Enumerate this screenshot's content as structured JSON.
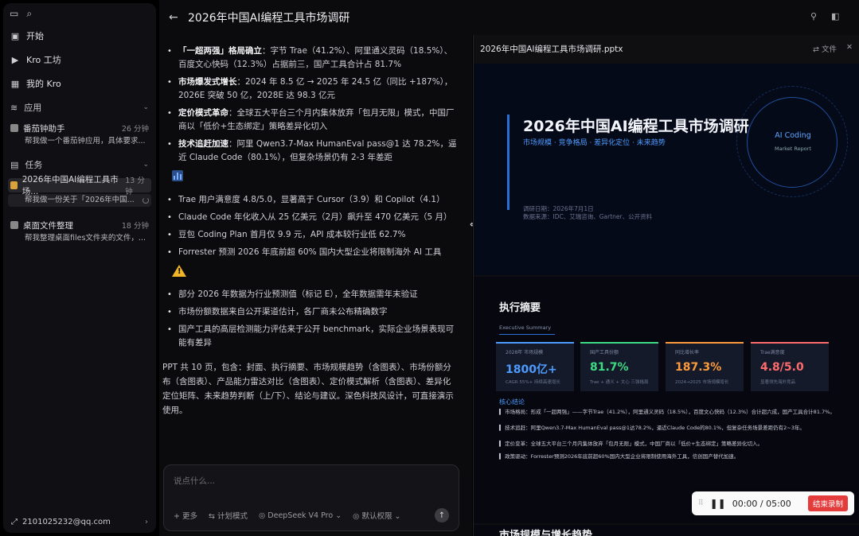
{
  "sidebar": {
    "nav": [
      {
        "icon": "chat-icon",
        "label": "开始"
      },
      {
        "icon": "play-icon",
        "label": "Kro 工坊"
      },
      {
        "icon": "grid-icon",
        "label": "我的 Kro"
      }
    ],
    "apps_label": "应用",
    "app_items": [
      {
        "title": "番茄钟助手",
        "time": "26 分钟",
        "sub": "帮我做一个番茄钟应用，具体要求..."
      }
    ],
    "tasks_label": "任务",
    "task_items": [
      {
        "title": "2026年中国AI编程工具市场...",
        "time": "13 分钟",
        "sub": "帮我做一份关于「2026年中国..."
      },
      {
        "title": "桌面文件整理",
        "time": "18 分钟",
        "sub": "帮我整理桌面files文件夹的文件，..."
      }
    ],
    "user_email": "2101025232@qq.com"
  },
  "topbar": {
    "title": "2026年中国AI编程工具市场调研"
  },
  "chat": {
    "bullets_a": [
      {
        "bold": "「一超两强」格局确立",
        "text": "：字节 Trae（41.2%）、阿里通义灵码（18.5%）、百度文心快码（12.3%）占据前三，国产工具合计占 81.7%"
      },
      {
        "bold": "市场爆发式增长",
        "text": "：2024 年 8.5 亿 → 2025 年 24.5 亿（同比 +187%），2026E 突破 50 亿，2028E 达 98.3 亿元"
      },
      {
        "bold": "定价模式革命",
        "text": "：全球五大平台三个月内集体放弃「包月无限」模式，中国厂商以「低价+生态绑定」策略差异化切入"
      },
      {
        "bold": "技术追赶加速",
        "text": "：阿里 Qwen3.7-Max HumanEval pass@1 达 78.2%，逼近 Claude Code（80.1%），但复杂场景仍有 2-3 年差距"
      }
    ],
    "bullets_b": [
      "Trae 用户满意度 4.8/5.0，显著高于 Cursor（3.9）和 Copilot（4.1）",
      "Claude Code 年化收入从 25 亿美元（2月）飙升至 470 亿美元（5 月）",
      "豆包 Coding Plan 首月仅 9.9 元，API 成本较行业低 62.7%",
      "Forrester 预测 2026 年底前超 60% 国内大型企业将限制海外 AI 工具"
    ],
    "bullets_c": [
      "部分 2026 年数据为行业预测值（标记 E），全年数据需年末验证",
      "市场份额数据来自公开渠道估计，各厂商未公布精确数字",
      "国产工具的高层检测能力评估来于公开 benchmark，实际企业场景表现可能有差异"
    ],
    "summary": "PPT 共 10 页，包含：封面、执行摘要、市场规模趋势（含图表）、市场份额分布（含图表）、产品能力雷达对比（含图表）、定价模式解析（含图表）、差异化定位矩阵、未来趋势判断（上/下）、结论与建议。深色科技风设计，可直接演示使用。",
    "input": {
      "placeholder": "说点什么...",
      "more": "+ 更多",
      "plan": "⇆ 计划模式",
      "model": "◎ DeepSeek V4 Pro ⌄",
      "default": "◎ 默认权限 ⌄"
    }
  },
  "preview": {
    "filename": "2026年中国AI编程工具市场调研.pptx",
    "file_btn": "⇄ 文件",
    "slide1": {
      "title": "2026年中国AI编程工具市场调研",
      "subtitle": "市场规模 · 竞争格局 · 差异化定位 · 未来趋势",
      "meta": "调研日期：2026年7月1日",
      "meta2": "数据来源：IDC、艾瑞咨询、Gartner、公开资料",
      "circle_title": "AI Coding",
      "circle_sub": "Market Report"
    },
    "slide2": {
      "title": "执行摘要",
      "subtitle": "Executive Summary",
      "cards": [
        {
          "label": "2028年 市场规模",
          "value": "1800亿+",
          "note": "CAGR 55%+ 持续高速增长",
          "color": "#4e9bff"
        },
        {
          "label": "国产工具份额",
          "value": "81.7%",
          "note": "Trae + 通义 + 文心 三强格局",
          "color": "#3ddc84"
        },
        {
          "label": "同比增长率",
          "value": "187.3%",
          "note": "2024→2025 市场规模增长",
          "color": "#ff9a3c"
        },
        {
          "label": "Trae满意度",
          "value": "4.8/5.0",
          "note": "显著领先海外竞品",
          "color": "#ff6b6b"
        }
      ],
      "key_title": "核心结论",
      "points": [
        "▍ 市场格局：形成「一超两强」——字节Trae（41.2%），阿里通义灵码（18.5%），百度文心快码（12.3%）合计超六成，国产工具合计81.7%。",
        "▍ 技术追赶：阿里Qwen3.7-Max HumanEval pass@1达78.2%，逼近Claude Code的80.1%，但复杂任务场景差距仍有2~3年。",
        "▍ 定价变革：全球五大平台三个月内集体放弃「包月无限」模式，中国厂商以「低价+生态绑定」策略差异化切入。",
        "▍ 政策驱动：Forrester预测2026年底前超60%国内大型企业将限制使用海外工具，信创国产替代加速。"
      ]
    },
    "slide3_title": "市场规模与增长趋势"
  },
  "recorder": {
    "time": "00:00 / 05:00",
    "stop": "结束录制"
  }
}
